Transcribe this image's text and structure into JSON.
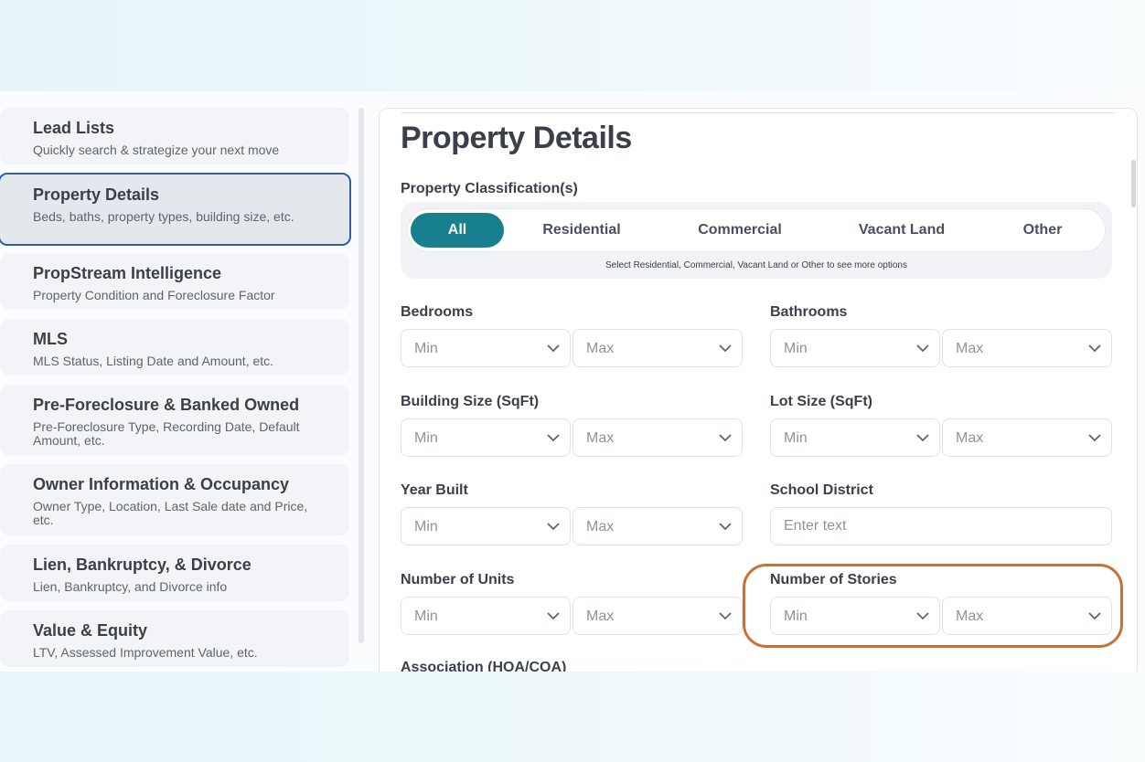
{
  "sidebar": {
    "items": [
      {
        "title": "Lead Lists",
        "subtitle": "Quickly search & strategize your next move"
      },
      {
        "title": "Property Details",
        "subtitle": "Beds, baths, property types, building size, etc."
      },
      {
        "title": "PropStream Intelligence",
        "subtitle": "Property Condition and Foreclosure Factor"
      },
      {
        "title": "MLS",
        "subtitle": "MLS Status, Listing Date and Amount, etc."
      },
      {
        "title": "Pre-Foreclosure & Banked Owned",
        "subtitle": "Pre-Foreclosure Type, Recording Date, Default Amount, etc."
      },
      {
        "title": "Owner Information & Occupancy",
        "subtitle": "Owner Type, Location, Last Sale date and Price, etc."
      },
      {
        "title": "Lien, Bankruptcy, & Divorce",
        "subtitle": "Lien, Bankruptcy, and Divorce info"
      },
      {
        "title": "Value & Equity",
        "subtitle": "LTV, Assessed Improvement Value, etc."
      }
    ],
    "active_index": 1
  },
  "main": {
    "title": "Property Details",
    "classification": {
      "label": "Property Classification(s)",
      "options": [
        "All",
        "Residential",
        "Commercial",
        "Vacant Land",
        "Other"
      ],
      "selected": "All",
      "hint": "Select Residential, Commercial, Vacant Land or Other to see more options"
    },
    "filters": {
      "bedrooms": {
        "label": "Bedrooms",
        "min": "Min",
        "max": "Max"
      },
      "bathrooms": {
        "label": "Bathrooms",
        "min": "Min",
        "max": "Max"
      },
      "building_size": {
        "label": "Building Size (SqFt)",
        "min": "Min",
        "max": "Max"
      },
      "lot_size": {
        "label": "Lot Size (SqFt)",
        "min": "Min",
        "max": "Max"
      },
      "year_built": {
        "label": "Year Built",
        "min": "Min",
        "max": "Max"
      },
      "school_district": {
        "label": "School District",
        "placeholder": "Enter text"
      },
      "number_of_units": {
        "label": "Number of Units",
        "min": "Min",
        "max": "Max"
      },
      "number_of_stories": {
        "label": "Number of Stories",
        "min": "Min",
        "max": "Max"
      },
      "association": {
        "label": "Association (HOA/COA)"
      }
    }
  },
  "colors": {
    "accent": "#177f8e",
    "active_border": "#2f5fa8",
    "highlight": "#c97134"
  }
}
